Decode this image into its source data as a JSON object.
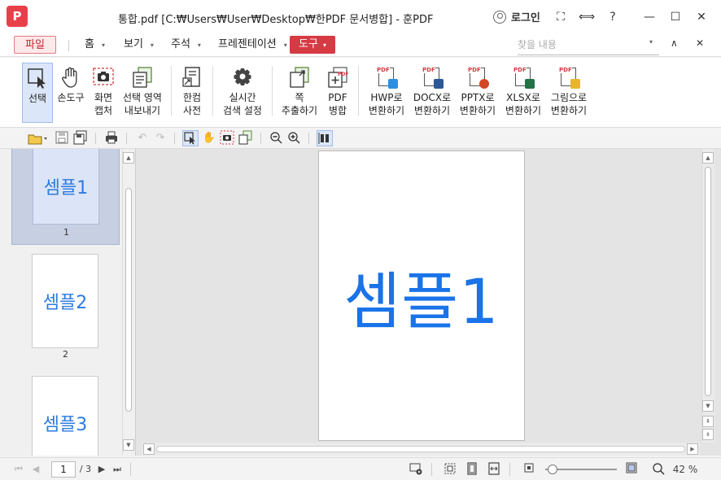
{
  "app": {
    "logo_glyph": "P",
    "window_title": "통합.pdf [C:₩Users₩User₩Desktop₩한PDF 문서병합] - 훈PDF",
    "login_label": "로그인",
    "accent": "#d63a43"
  },
  "window_buttons": {
    "fullscreen": "⛶",
    "split": "⟺",
    "help": "?",
    "minimize": "—",
    "maximize": "☐",
    "close": "✕"
  },
  "menu": {
    "file": "파일",
    "home": "홈",
    "view": "보기",
    "annotate": "주석",
    "presentation": "프레젠테이션",
    "tools": "도구",
    "caret": "▾",
    "find_placeholder": "찾을 내용",
    "find_caret": "▾",
    "collapse": "∧",
    "close": "✕"
  },
  "ribbon": {
    "select": "선택",
    "hand": "손도구",
    "capture_1": "화면",
    "capture_2": "캡처",
    "export_area_1": "선택 영역",
    "export_area_2": "내보내기",
    "dictionary_1": "한컴",
    "dictionary_2": "사전",
    "search_settings_1": "실시간",
    "search_settings_2": "검색 설정",
    "extract_1": "쪽",
    "extract_2": "추출하기",
    "merge_1": "PDF",
    "merge_2": "병합",
    "to_hwp_1": "HWP로",
    "to_hwp_2": "변환하기",
    "to_docx_1": "DOCX로",
    "to_docx_2": "변환하기",
    "to_pptx_1": "PPTX로",
    "to_pptx_2": "변환하기",
    "to_xlsx_1": "XLSX로",
    "to_xlsx_2": "변환하기",
    "to_image_1": "그림으로",
    "to_image_2": "변환하기",
    "pdf_tag": "PDF"
  },
  "thumbnails": [
    {
      "text": "셈플1",
      "number": "1"
    },
    {
      "text": "셈플2",
      "number": "2"
    },
    {
      "text": "셈플3",
      "number": ""
    }
  ],
  "viewer": {
    "page_text": "셈플1"
  },
  "status": {
    "current_page": "1",
    "total_pages": "/ 3",
    "zoom": "42 %",
    "zoom_level": 0.1
  }
}
